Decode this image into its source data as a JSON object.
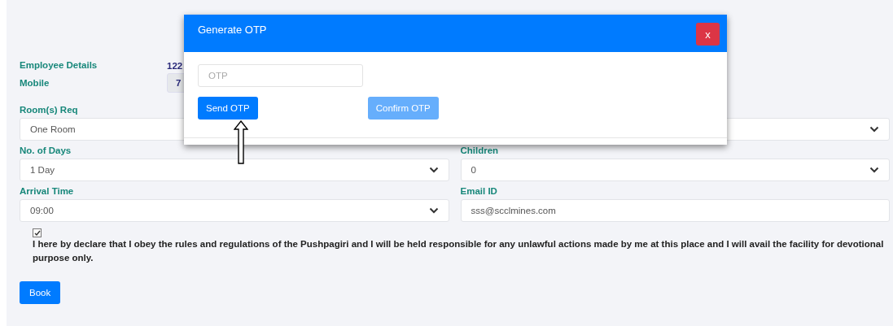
{
  "employee": {
    "label": "Employee Details",
    "value": "122"
  },
  "mobile": {
    "label": "Mobile",
    "value": "7"
  },
  "room_req": {
    "label": "Room(s) Req",
    "kind": "select",
    "value": "One Room"
  },
  "rows": [
    [
      {
        "label": "No. of Days",
        "kind": "select",
        "value": "1 Day"
      },
      {
        "label": "Children",
        "kind": "select",
        "value": "0"
      }
    ],
    [
      {
        "label": "Arrival Time",
        "kind": "select",
        "value": "09:00"
      },
      {
        "label": "Email ID",
        "kind": "input",
        "value": "sss@scclmines.com"
      }
    ]
  ],
  "declaration": {
    "checked": true,
    "text": "I here by declare that I obey the rules and regulations of the Pushpagiri and I will be held responsible for any unlawful actions made by me at this place and I will avail the facility for devotional purpose only."
  },
  "book_button": "Book",
  "modal": {
    "title": "Generate OTP",
    "close": "x",
    "otp_placeholder": "OTP",
    "send_button": "Send OTP",
    "confirm_button": {
      "label": "Confirm OTP",
      "disabled": true
    }
  }
}
